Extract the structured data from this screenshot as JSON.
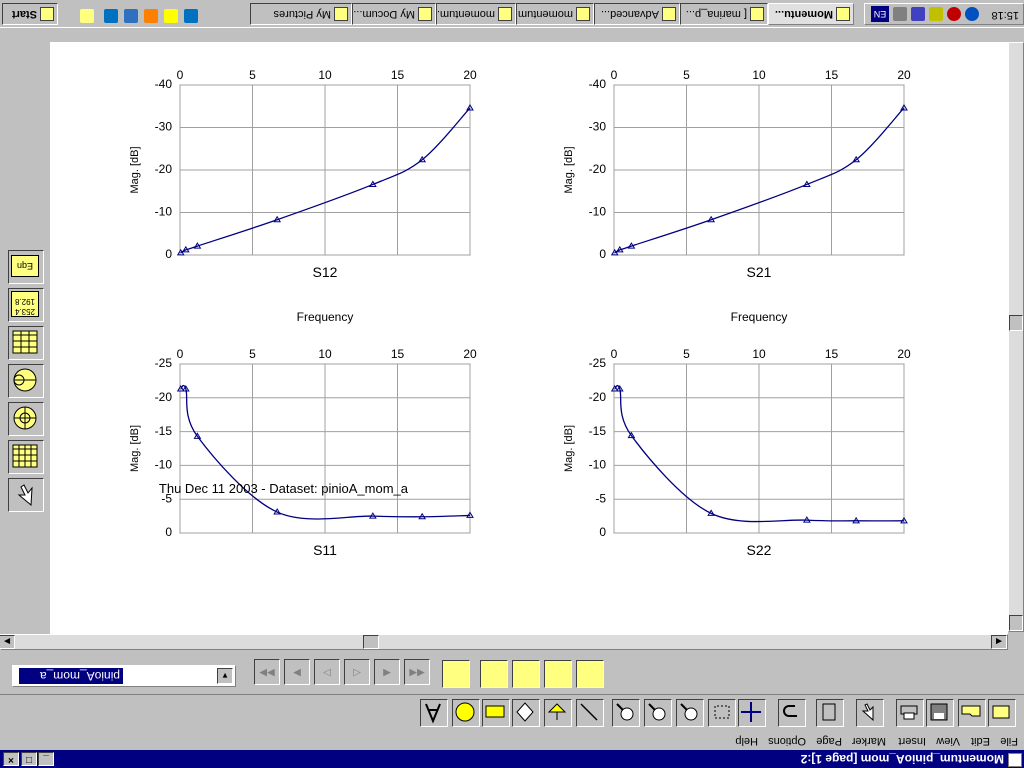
{
  "window": {
    "title": "Momentum_pinioA_mom [page 1]:2"
  },
  "menu": [
    "File",
    "Edit",
    "View",
    "Insert",
    "Marker",
    "Page",
    "Options",
    "Help"
  ],
  "toolbar": {
    "dataset_value": "pinioA_mom_a",
    "tools": [
      "new-page-icon",
      "open-icon",
      "save-icon",
      "print-icon",
      "pointer-icon",
      "clipboard-icon",
      "undo-icon",
      "pan-icon",
      "zoom-box-icon",
      "magnifier-plus-icon",
      "magnifier-minus-icon",
      "zoom-1-icon",
      "line-icon",
      "arrow-down-icon",
      "diamond-icon",
      "rectangle-icon",
      "ellipse-icon",
      "text-icon"
    ]
  },
  "palette": [
    "select-arrow-icon",
    "table-grid-icon",
    "smith-chart-icon",
    "polar-chart-icon",
    "list-icon",
    "marker-value-icon",
    "equation-icon"
  ],
  "palette_text": {
    "marker_value": "253.4\n192.8",
    "equation": "Eqn"
  },
  "page": {
    "footer": "Thu Dec 11 2003 - Dataset: pinioA_mom_a"
  },
  "chart_data": [
    {
      "type": "line",
      "title": "",
      "xlabel": "Frequency",
      "ylabel": "Mag. [dB]",
      "legend": "S12",
      "xlim": [
        0,
        20
      ],
      "ylim": [
        0,
        40
      ],
      "xticks": [
        0,
        5,
        10,
        15,
        20
      ],
      "yticks": [
        0,
        10,
        20,
        30,
        40
      ],
      "ytick_labels": [
        "0",
        "-10",
        "-20",
        "-30",
        "-40"
      ],
      "x": [
        0.05,
        0.4,
        1.2,
        6.7,
        13.3,
        16.7,
        20
      ],
      "y": [
        0.5,
        1.2,
        2.1,
        8.3,
        16.6,
        22.4,
        34.6
      ],
      "color": "#000080"
    },
    {
      "type": "line",
      "title": "",
      "xlabel": "Frequency",
      "ylabel": "Mag. [dB]",
      "legend": "S21",
      "xlim": [
        0,
        20
      ],
      "ylim": [
        0,
        40
      ],
      "xticks": [
        0,
        5,
        10,
        15,
        20
      ],
      "yticks": [
        0,
        10,
        20,
        30,
        40
      ],
      "ytick_labels": [
        "0",
        "-10",
        "-20",
        "-30",
        "-40"
      ],
      "x": [
        0.05,
        0.4,
        1.2,
        6.7,
        13.3,
        16.7,
        20
      ],
      "y": [
        0.5,
        1.2,
        2.1,
        8.3,
        16.6,
        22.4,
        34.6
      ],
      "color": "#000080"
    },
    {
      "type": "line",
      "title": "",
      "xlabel": "",
      "ylabel": "Mag. [dB]",
      "legend": "S11",
      "xlim": [
        0,
        20
      ],
      "ylim": [
        0,
        25
      ],
      "xticks": [
        0,
        5,
        10,
        15,
        20
      ],
      "yticks": [
        0,
        5,
        10,
        15,
        20,
        25
      ],
      "ytick_labels": [
        "0",
        "-5",
        "-10",
        "-15",
        "-20",
        "-25"
      ],
      "x": [
        0.05,
        0.4,
        1.2,
        6.7,
        13.3,
        16.7,
        20
      ],
      "y": [
        21.3,
        21.3,
        14.3,
        3.1,
        2.5,
        2.4,
        2.6
      ],
      "color": "#000080"
    },
    {
      "type": "line",
      "title": "",
      "xlabel": "",
      "ylabel": "Mag. [dB]",
      "legend": "S22",
      "xlim": [
        0,
        20
      ],
      "ylim": [
        0,
        25
      ],
      "xticks": [
        0,
        5,
        10,
        15,
        20
      ],
      "yticks": [
        0,
        5,
        10,
        15,
        20,
        25
      ],
      "ytick_labels": [
        "0",
        "-5",
        "-10",
        "-15",
        "-20",
        "-25"
      ],
      "x": [
        0.05,
        0.4,
        1.2,
        6.7,
        13.3,
        16.7,
        20
      ],
      "y": [
        21.3,
        21.3,
        14.4,
        2.9,
        1.9,
        1.8,
        1.8
      ],
      "color": "#000080"
    }
  ],
  "taskbar": {
    "start": "Start",
    "tasks": [
      "My Pictures",
      "My Docum...",
      "momentum...",
      "momentum...",
      "Advanced...",
      "[ marina_p...",
      "Momentu..."
    ],
    "lang": "EN",
    "clock": "15:18"
  }
}
